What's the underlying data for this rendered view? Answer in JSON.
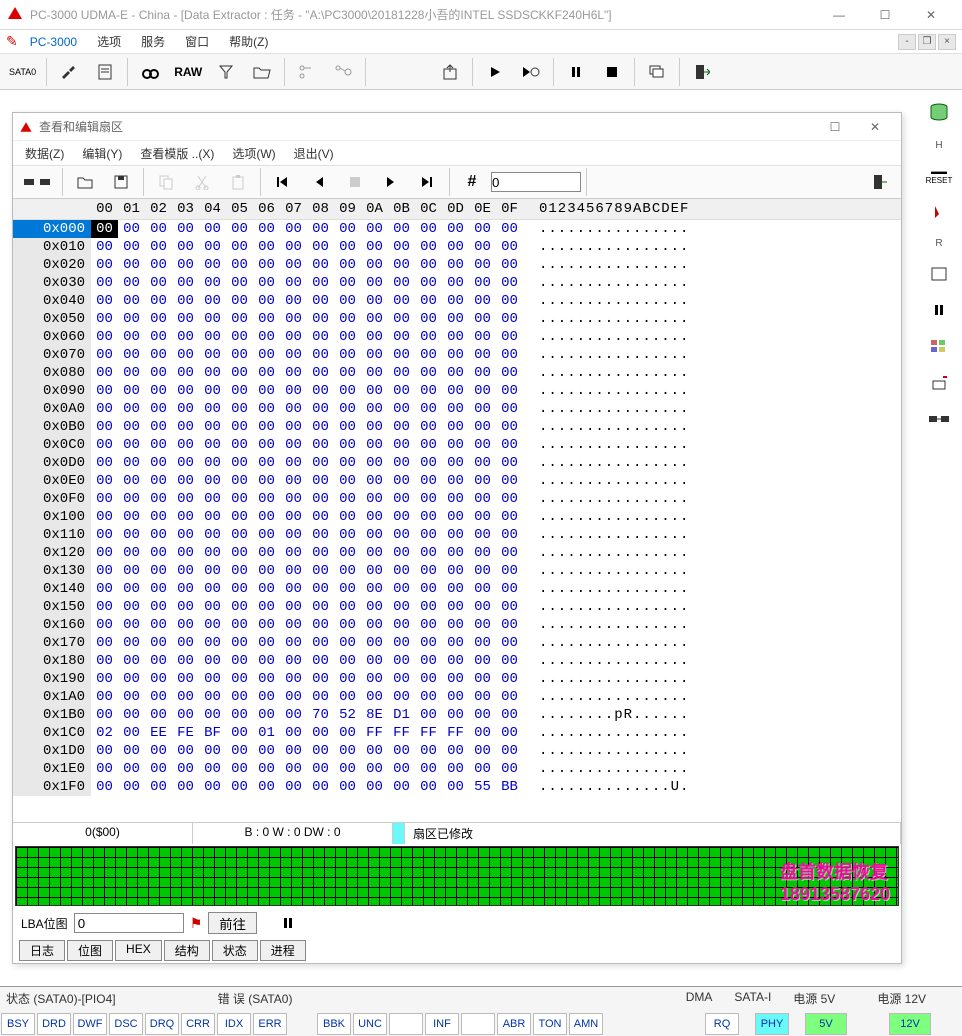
{
  "window": {
    "title": "PC-3000 UDMA-E - China - [Data Extractor : 任务 - \"A:\\PC3000\\20181228小吾的INTEL SSDSCKKF240H6L\"]"
  },
  "menubar": {
    "brand": "PC-3000",
    "items": [
      "选项",
      "服务",
      "窗口",
      "帮助(Z)"
    ]
  },
  "toolbar": {
    "sata_label": "SATA0",
    "raw_label": "RAW"
  },
  "subwindow": {
    "title": "查看和编辑扇区",
    "menu": [
      "数据(Z)",
      "编辑(Y)",
      "查看模版 ..(X)",
      "选项(W)",
      "退出(V)"
    ],
    "goto_value": "0"
  },
  "hex": {
    "header_cols": [
      "00",
      "01",
      "02",
      "03",
      "04",
      "05",
      "06",
      "07",
      "08",
      "09",
      "0A",
      "0B",
      "0C",
      "0D",
      "0E",
      "0F"
    ],
    "ascii_header": "0123456789ABCDEF",
    "rows": [
      {
        "off": "0x000",
        "b": [
          "00",
          "00",
          "00",
          "00",
          "00",
          "00",
          "00",
          "00",
          "00",
          "00",
          "00",
          "00",
          "00",
          "00",
          "00",
          "00"
        ],
        "a": "................"
      },
      {
        "off": "0x010",
        "b": [
          "00",
          "00",
          "00",
          "00",
          "00",
          "00",
          "00",
          "00",
          "00",
          "00",
          "00",
          "00",
          "00",
          "00",
          "00",
          "00"
        ],
        "a": "................"
      },
      {
        "off": "0x020",
        "b": [
          "00",
          "00",
          "00",
          "00",
          "00",
          "00",
          "00",
          "00",
          "00",
          "00",
          "00",
          "00",
          "00",
          "00",
          "00",
          "00"
        ],
        "a": "................"
      },
      {
        "off": "0x030",
        "b": [
          "00",
          "00",
          "00",
          "00",
          "00",
          "00",
          "00",
          "00",
          "00",
          "00",
          "00",
          "00",
          "00",
          "00",
          "00",
          "00"
        ],
        "a": "................"
      },
      {
        "off": "0x040",
        "b": [
          "00",
          "00",
          "00",
          "00",
          "00",
          "00",
          "00",
          "00",
          "00",
          "00",
          "00",
          "00",
          "00",
          "00",
          "00",
          "00"
        ],
        "a": "................"
      },
      {
        "off": "0x050",
        "b": [
          "00",
          "00",
          "00",
          "00",
          "00",
          "00",
          "00",
          "00",
          "00",
          "00",
          "00",
          "00",
          "00",
          "00",
          "00",
          "00"
        ],
        "a": "................"
      },
      {
        "off": "0x060",
        "b": [
          "00",
          "00",
          "00",
          "00",
          "00",
          "00",
          "00",
          "00",
          "00",
          "00",
          "00",
          "00",
          "00",
          "00",
          "00",
          "00"
        ],
        "a": "................"
      },
      {
        "off": "0x070",
        "b": [
          "00",
          "00",
          "00",
          "00",
          "00",
          "00",
          "00",
          "00",
          "00",
          "00",
          "00",
          "00",
          "00",
          "00",
          "00",
          "00"
        ],
        "a": "................"
      },
      {
        "off": "0x080",
        "b": [
          "00",
          "00",
          "00",
          "00",
          "00",
          "00",
          "00",
          "00",
          "00",
          "00",
          "00",
          "00",
          "00",
          "00",
          "00",
          "00"
        ],
        "a": "................"
      },
      {
        "off": "0x090",
        "b": [
          "00",
          "00",
          "00",
          "00",
          "00",
          "00",
          "00",
          "00",
          "00",
          "00",
          "00",
          "00",
          "00",
          "00",
          "00",
          "00"
        ],
        "a": "................"
      },
      {
        "off": "0x0A0",
        "b": [
          "00",
          "00",
          "00",
          "00",
          "00",
          "00",
          "00",
          "00",
          "00",
          "00",
          "00",
          "00",
          "00",
          "00",
          "00",
          "00"
        ],
        "a": "................"
      },
      {
        "off": "0x0B0",
        "b": [
          "00",
          "00",
          "00",
          "00",
          "00",
          "00",
          "00",
          "00",
          "00",
          "00",
          "00",
          "00",
          "00",
          "00",
          "00",
          "00"
        ],
        "a": "................"
      },
      {
        "off": "0x0C0",
        "b": [
          "00",
          "00",
          "00",
          "00",
          "00",
          "00",
          "00",
          "00",
          "00",
          "00",
          "00",
          "00",
          "00",
          "00",
          "00",
          "00"
        ],
        "a": "................"
      },
      {
        "off": "0x0D0",
        "b": [
          "00",
          "00",
          "00",
          "00",
          "00",
          "00",
          "00",
          "00",
          "00",
          "00",
          "00",
          "00",
          "00",
          "00",
          "00",
          "00"
        ],
        "a": "................"
      },
      {
        "off": "0x0E0",
        "b": [
          "00",
          "00",
          "00",
          "00",
          "00",
          "00",
          "00",
          "00",
          "00",
          "00",
          "00",
          "00",
          "00",
          "00",
          "00",
          "00"
        ],
        "a": "................"
      },
      {
        "off": "0x0F0",
        "b": [
          "00",
          "00",
          "00",
          "00",
          "00",
          "00",
          "00",
          "00",
          "00",
          "00",
          "00",
          "00",
          "00",
          "00",
          "00",
          "00"
        ],
        "a": "................"
      },
      {
        "off": "0x100",
        "b": [
          "00",
          "00",
          "00",
          "00",
          "00",
          "00",
          "00",
          "00",
          "00",
          "00",
          "00",
          "00",
          "00",
          "00",
          "00",
          "00"
        ],
        "a": "................"
      },
      {
        "off": "0x110",
        "b": [
          "00",
          "00",
          "00",
          "00",
          "00",
          "00",
          "00",
          "00",
          "00",
          "00",
          "00",
          "00",
          "00",
          "00",
          "00",
          "00"
        ],
        "a": "................"
      },
      {
        "off": "0x120",
        "b": [
          "00",
          "00",
          "00",
          "00",
          "00",
          "00",
          "00",
          "00",
          "00",
          "00",
          "00",
          "00",
          "00",
          "00",
          "00",
          "00"
        ],
        "a": "................"
      },
      {
        "off": "0x130",
        "b": [
          "00",
          "00",
          "00",
          "00",
          "00",
          "00",
          "00",
          "00",
          "00",
          "00",
          "00",
          "00",
          "00",
          "00",
          "00",
          "00"
        ],
        "a": "................"
      },
      {
        "off": "0x140",
        "b": [
          "00",
          "00",
          "00",
          "00",
          "00",
          "00",
          "00",
          "00",
          "00",
          "00",
          "00",
          "00",
          "00",
          "00",
          "00",
          "00"
        ],
        "a": "................"
      },
      {
        "off": "0x150",
        "b": [
          "00",
          "00",
          "00",
          "00",
          "00",
          "00",
          "00",
          "00",
          "00",
          "00",
          "00",
          "00",
          "00",
          "00",
          "00",
          "00"
        ],
        "a": "................"
      },
      {
        "off": "0x160",
        "b": [
          "00",
          "00",
          "00",
          "00",
          "00",
          "00",
          "00",
          "00",
          "00",
          "00",
          "00",
          "00",
          "00",
          "00",
          "00",
          "00"
        ],
        "a": "................"
      },
      {
        "off": "0x170",
        "b": [
          "00",
          "00",
          "00",
          "00",
          "00",
          "00",
          "00",
          "00",
          "00",
          "00",
          "00",
          "00",
          "00",
          "00",
          "00",
          "00"
        ],
        "a": "................"
      },
      {
        "off": "0x180",
        "b": [
          "00",
          "00",
          "00",
          "00",
          "00",
          "00",
          "00",
          "00",
          "00",
          "00",
          "00",
          "00",
          "00",
          "00",
          "00",
          "00"
        ],
        "a": "................"
      },
      {
        "off": "0x190",
        "b": [
          "00",
          "00",
          "00",
          "00",
          "00",
          "00",
          "00",
          "00",
          "00",
          "00",
          "00",
          "00",
          "00",
          "00",
          "00",
          "00"
        ],
        "a": "................"
      },
      {
        "off": "0x1A0",
        "b": [
          "00",
          "00",
          "00",
          "00",
          "00",
          "00",
          "00",
          "00",
          "00",
          "00",
          "00",
          "00",
          "00",
          "00",
          "00",
          "00"
        ],
        "a": "................"
      },
      {
        "off": "0x1B0",
        "b": [
          "00",
          "00",
          "00",
          "00",
          "00",
          "00",
          "00",
          "00",
          "70",
          "52",
          "8E",
          "D1",
          "00",
          "00",
          "00",
          "00"
        ],
        "a": "........pR......"
      },
      {
        "off": "0x1C0",
        "b": [
          "02",
          "00",
          "EE",
          "FE",
          "BF",
          "00",
          "01",
          "00",
          "00",
          "00",
          "FF",
          "FF",
          "FF",
          "FF",
          "00",
          "00"
        ],
        "a": "................"
      },
      {
        "off": "0x1D0",
        "b": [
          "00",
          "00",
          "00",
          "00",
          "00",
          "00",
          "00",
          "00",
          "00",
          "00",
          "00",
          "00",
          "00",
          "00",
          "00",
          "00"
        ],
        "a": "................"
      },
      {
        "off": "0x1E0",
        "b": [
          "00",
          "00",
          "00",
          "00",
          "00",
          "00",
          "00",
          "00",
          "00",
          "00",
          "00",
          "00",
          "00",
          "00",
          "00",
          "00"
        ],
        "a": "................"
      },
      {
        "off": "0x1F0",
        "b": [
          "00",
          "00",
          "00",
          "00",
          "00",
          "00",
          "00",
          "00",
          "00",
          "00",
          "00",
          "00",
          "00",
          "00",
          "55",
          "BB"
        ],
        "a": "..............U."
      }
    ]
  },
  "status": {
    "left": "0($00)",
    "mid": "B : 0 W : 0 DW : 0",
    "right": "扇区已修改"
  },
  "lba": {
    "label": "LBA位图",
    "value": "0",
    "goto": "前往"
  },
  "tabs": [
    "日志",
    "位图",
    "HEX",
    "结构",
    "状态",
    "进程"
  ],
  "watermark": {
    "line1": "盘首数据恢复",
    "line2": "18913587620"
  },
  "bottom": {
    "status_label": "状态 (SATA0)-[PIO4]",
    "status_inds": [
      "BSY",
      "DRD",
      "DWF",
      "DSC",
      "DRQ",
      "CRR",
      "IDX",
      "ERR"
    ],
    "error_label": "错 误 (SATA0)",
    "error_inds": [
      "BBK",
      "UNC",
      "",
      "INF",
      "",
      "ABR",
      "TON",
      "AMN"
    ],
    "dma_label": "DMA",
    "dma_inds": [
      "RQ"
    ],
    "satai_label": "SATA-I",
    "satai_inds": [
      "PHY"
    ],
    "p5_label": "电源 5V",
    "p5_inds": [
      "5V"
    ],
    "p12_label": "电源 12V",
    "p12_inds": [
      "12V"
    ]
  },
  "right_dock": {
    "reset": "RESET",
    "h": "H",
    "r": "R"
  }
}
